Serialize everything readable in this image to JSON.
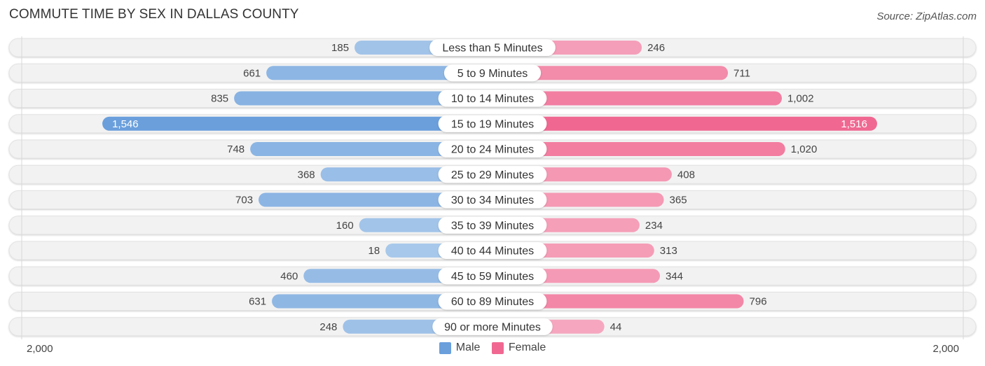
{
  "header": {
    "title": "COMMUTE TIME BY SEX IN DALLAS COUNTY",
    "source": "Source: ZipAtlas.com"
  },
  "colors": {
    "male": "#6a9fdc",
    "male_light": "#a8c8ea",
    "female": "#f06892",
    "female_light": "#f6a9c0",
    "row_bg": "#f2f2f2",
    "label_pill": "#ffffff"
  },
  "chart_data": {
    "type": "bar",
    "orientation": "horizontal-diverging",
    "title": "COMMUTE TIME BY SEX IN DALLAS COUNTY",
    "categories": [
      "Less than 5 Minutes",
      "5 to 9 Minutes",
      "10 to 14 Minutes",
      "15 to 19 Minutes",
      "20 to 24 Minutes",
      "25 to 29 Minutes",
      "30 to 34 Minutes",
      "35 to 39 Minutes",
      "40 to 44 Minutes",
      "45 to 59 Minutes",
      "60 to 89 Minutes",
      "90 or more Minutes"
    ],
    "series": [
      {
        "name": "Male",
        "side": "left",
        "values": [
          185,
          661,
          835,
          1546,
          748,
          368,
          703,
          160,
          18,
          460,
          631,
          248
        ],
        "labels": [
          "185",
          "661",
          "835",
          "1,546",
          "748",
          "368",
          "703",
          "160",
          "18",
          "460",
          "631",
          "248"
        ]
      },
      {
        "name": "Female",
        "side": "right",
        "values": [
          246,
          711,
          1002,
          1516,
          1020,
          408,
          365,
          234,
          313,
          344,
          796,
          44
        ],
        "labels": [
          "246",
          "711",
          "1,002",
          "1,516",
          "1,020",
          "408",
          "365",
          "234",
          "313",
          "344",
          "796",
          "44"
        ]
      }
    ],
    "axis": {
      "left_label": "2,000",
      "right_label": "2,000",
      "max": 2000
    },
    "legend": {
      "position": "bottom-center",
      "entries": [
        "Male",
        "Female"
      ]
    }
  }
}
